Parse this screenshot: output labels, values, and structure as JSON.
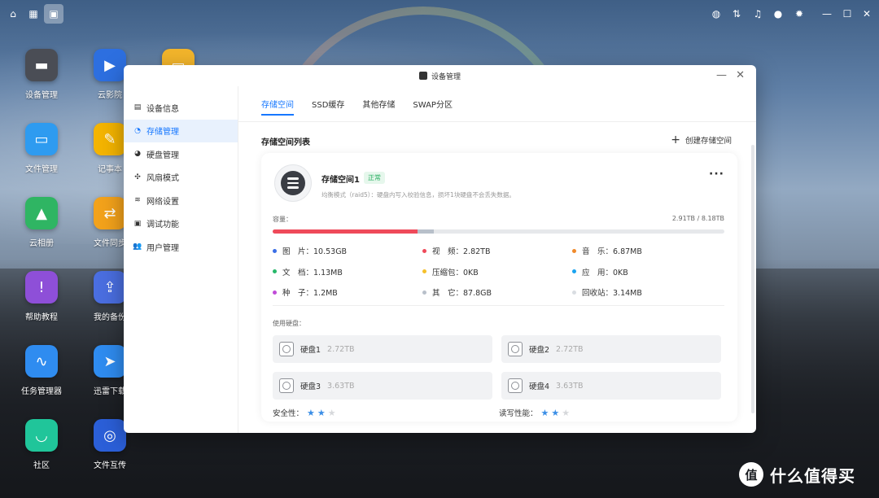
{
  "desktop": {
    "icons": [
      {
        "label": "设备管理",
        "icon": "device-manager-icon",
        "color": "#4a4d55"
      },
      {
        "label": "云影院",
        "icon": "cloud-cinema-icon",
        "color": "#2d6fe0"
      },
      {
        "label": "文件管理",
        "icon": "file-manager-icon",
        "color": "#2e9bf0"
      },
      {
        "label": "记事本",
        "icon": "notepad-icon",
        "color": "#f4b400"
      },
      {
        "label": "云相册",
        "icon": "cloud-album-icon",
        "color": "#2fb563"
      },
      {
        "label": "文件同步",
        "icon": "file-sync-icon",
        "color": "#f3a21b"
      },
      {
        "label": "帮助教程",
        "icon": "help-icon",
        "color": "#8e4fd8"
      },
      {
        "label": "我的备份",
        "icon": "backup-icon",
        "color": "#4a6ee0"
      },
      {
        "label": "任务管理器",
        "icon": "task-manager-icon",
        "color": "#2f8cf0"
      },
      {
        "label": "迅雷下载",
        "icon": "thunder-icon",
        "color": "#2f8cf0"
      },
      {
        "label": "社区",
        "icon": "community-icon",
        "color": "#20c59a"
      },
      {
        "label": "文件互传",
        "icon": "file-transfer-icon",
        "color": "#2b5fd8"
      }
    ]
  },
  "window": {
    "title": "设备管理",
    "sidebar": [
      {
        "label": "设备信息",
        "icon": "info-icon",
        "glyph": "▤"
      },
      {
        "label": "存储管理",
        "icon": "storage-icon",
        "glyph": "◔"
      },
      {
        "label": "硬盘管理",
        "icon": "disk-icon",
        "glyph": "◕"
      },
      {
        "label": "风扇模式",
        "icon": "fan-icon",
        "glyph": "✣"
      },
      {
        "label": "网络设置",
        "icon": "wifi-icon",
        "glyph": "≋"
      },
      {
        "label": "调试功能",
        "icon": "debug-icon",
        "glyph": "▣"
      },
      {
        "label": "用户管理",
        "icon": "user-icon",
        "glyph": "👥"
      }
    ],
    "active_sidebar": "存储管理",
    "tabs": [
      "存储空间",
      "SSD缓存",
      "其他存储",
      "SWAP分区"
    ],
    "section_title": "存储空间列表",
    "create_label": "创建存储空间",
    "pool": {
      "name": "存储空间1",
      "status": "正常",
      "description": "均衡模式（raid5）：硬盘内写入校验信息，损坏1块硬盘不会丢失数据。",
      "capacity_label": "容量：",
      "capacity_value": "2.91TB / 8.18TB",
      "used_fraction": 0.356,
      "categories": [
        {
          "label": "图　片：10.53GB",
          "color": "#3a6ee6"
        },
        {
          "label": "视　频：2.82TB",
          "color": "#ef4a5a"
        },
        {
          "label": "音　乐：6.87MB",
          "color": "#f08a2b"
        },
        {
          "label": "文　档：1.13MB",
          "color": "#27b86a"
        },
        {
          "label": "压缩包：0KB",
          "color": "#f5c02b"
        },
        {
          "label": "应　用：0KB",
          "color": "#1ba4f0"
        },
        {
          "label": "种　子：1.2MB",
          "color": "#c04bd8"
        },
        {
          "label": "其　它：87.8GB",
          "color": "#b8c0ca"
        },
        {
          "label": "回收站：3.14MB",
          "color": "#d9dde2"
        }
      ],
      "disks_label": "使用硬盘：",
      "disks": [
        {
          "name": "硬盘1",
          "size": "2.72TB"
        },
        {
          "name": "硬盘2",
          "size": "2.72TB"
        },
        {
          "name": "硬盘3",
          "size": "3.63TB"
        },
        {
          "name": "硬盘4",
          "size": "3.63TB"
        }
      ],
      "security_label": "安全性：",
      "security_stars": 2,
      "performance_label": "读写性能：",
      "performance_stars": 2,
      "stars_max": 3
    }
  },
  "watermark": {
    "logo": "值",
    "text": "什么值得买"
  }
}
